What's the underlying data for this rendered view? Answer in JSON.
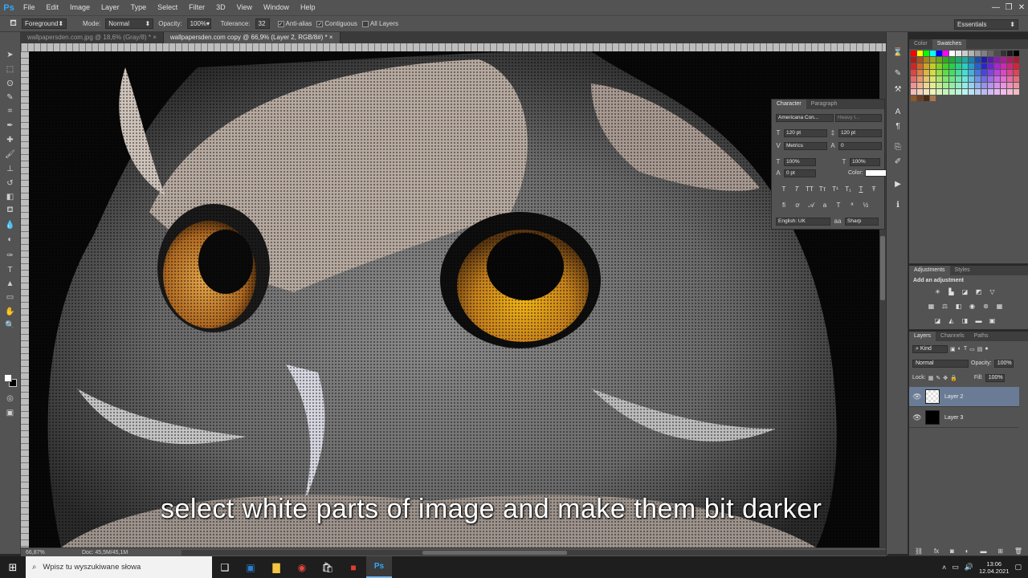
{
  "app": {
    "logo": "Ps"
  },
  "menu": [
    "File",
    "Edit",
    "Image",
    "Layer",
    "Type",
    "Select",
    "Filter",
    "3D",
    "View",
    "Window",
    "Help"
  ],
  "window_controls": {
    "minimize": "—",
    "restore": "❐",
    "close": "✕"
  },
  "options": {
    "fill_source": "Foreground",
    "mode_label": "Mode:",
    "mode_value": "Normal",
    "opacity_label": "Opacity:",
    "opacity_value": "100%",
    "tolerance_label": "Tolerance:",
    "tolerance_value": "32",
    "antialias_label": "Anti-alias",
    "contiguous_label": "Contiguous",
    "all_layers_label": "All Layers",
    "workspace": "Essentials"
  },
  "tabs": [
    {
      "label": "wallpapersden.com.jpg @ 18,6% (Gray/8) * ×"
    },
    {
      "label": "wallpapersden.com copy @ 66,9% (Layer 2, RGB/8#) * ×"
    }
  ],
  "caption": "select white parts of image and make them bit darker",
  "status": {
    "zoom": "66,87%",
    "doc": "Doc: 45,5M/45,1M"
  },
  "character": {
    "tabs": [
      "Character",
      "Paragraph"
    ],
    "font_family": "Americana Con...",
    "font_style": "Heavy I...",
    "size": "120 pt",
    "leading": "120 pt",
    "kerning": "Metrics",
    "tracking": "0",
    "vscale": "100%",
    "hscale": "100%",
    "baseline": "0 pt",
    "color_label": "Color:",
    "style_buttons": [
      "T",
      "T",
      "TT",
      "Tт",
      "T¹",
      "T₁",
      "T",
      "Ŧ"
    ],
    "language": "English: UK",
    "aa_icon": "aa",
    "antialias": "Sharp"
  },
  "swatches_panel": {
    "tabs": [
      "Color",
      "Swatches"
    ]
  },
  "adjustments": {
    "tabs": [
      "Adjustments",
      "Styles"
    ],
    "title": "Add an adjustment"
  },
  "layers": {
    "tabs": [
      "Layers",
      "Channels",
      "Paths"
    ],
    "kind": "Kind",
    "blend": "Normal",
    "opacity_label": "Opacity:",
    "opacity": "100%",
    "lock_label": "Lock:",
    "fill_label": "Fill:",
    "fill": "100%",
    "items": [
      {
        "name": "Layer 2",
        "selected": true
      },
      {
        "name": "Layer 3",
        "selected": false
      }
    ]
  },
  "taskbar": {
    "search_placeholder": "Wpisz tu wyszukiwane słowa",
    "time": "13:06",
    "date": "12.04.2021"
  }
}
